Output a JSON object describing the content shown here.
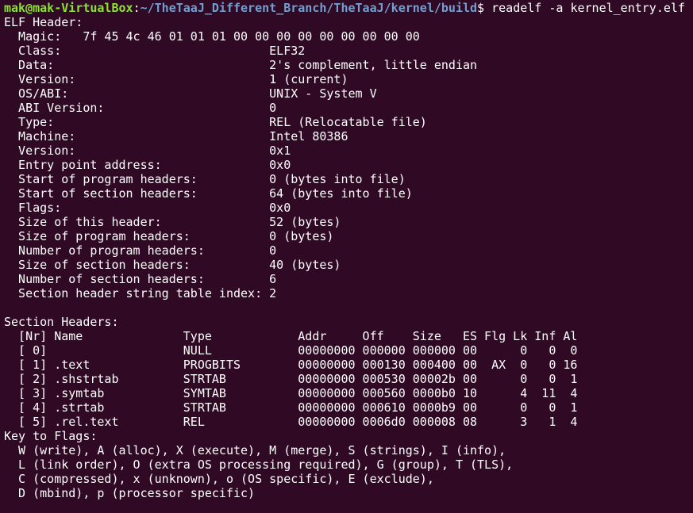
{
  "prompt": {
    "user_host": "mak@mak-VirtualBox",
    "separator": ":",
    "path": "~/TheTaaJ_Different_Branch/TheTaaJ/kernel/build",
    "symbol": "$ ",
    "command": "readelf -a kernel_entry.elf"
  },
  "output_lines": [
    "ELF Header:",
    "  Magic:   7f 45 4c 46 01 01 01 00 00 00 00 00 00 00 00 00",
    "  Class:                             ELF32",
    "  Data:                              2's complement, little endian",
    "  Version:                           1 (current)",
    "  OS/ABI:                            UNIX - System V",
    "  ABI Version:                       0",
    "  Type:                              REL (Relocatable file)",
    "  Machine:                           Intel 80386",
    "  Version:                           0x1",
    "  Entry point address:               0x0",
    "  Start of program headers:          0 (bytes into file)",
    "  Start of section headers:          64 (bytes into file)",
    "  Flags:                             0x0",
    "  Size of this header:               52 (bytes)",
    "  Size of program headers:           0 (bytes)",
    "  Number of program headers:         0",
    "  Size of section headers:           40 (bytes)",
    "  Number of section headers:         6",
    "  Section header string table index: 2",
    "",
    "Section Headers:",
    "  [Nr] Name              Type            Addr     Off    Size   ES Flg Lk Inf Al",
    "  [ 0]                   NULL            00000000 000000 000000 00      0   0  0",
    "  [ 1] .text             PROGBITS        00000000 000130 000400 00  AX  0   0 16",
    "  [ 2] .shstrtab         STRTAB          00000000 000530 00002b 00      0   0  1",
    "  [ 3] .symtab           SYMTAB          00000000 000560 0000b0 10      4  11  4",
    "  [ 4] .strtab           STRTAB          00000000 000610 0000b9 00      0   0  1",
    "  [ 5] .rel.text         REL             00000000 0006d0 000008 08      3   1  4",
    "Key to Flags:",
    "  W (write), A (alloc), X (execute), M (merge), S (strings), I (info),",
    "  L (link order), O (extra OS processing required), G (group), T (TLS),",
    "  C (compressed), x (unknown), o (OS specific), E (exclude),",
    "  D (mbind), p (processor specific)"
  ]
}
